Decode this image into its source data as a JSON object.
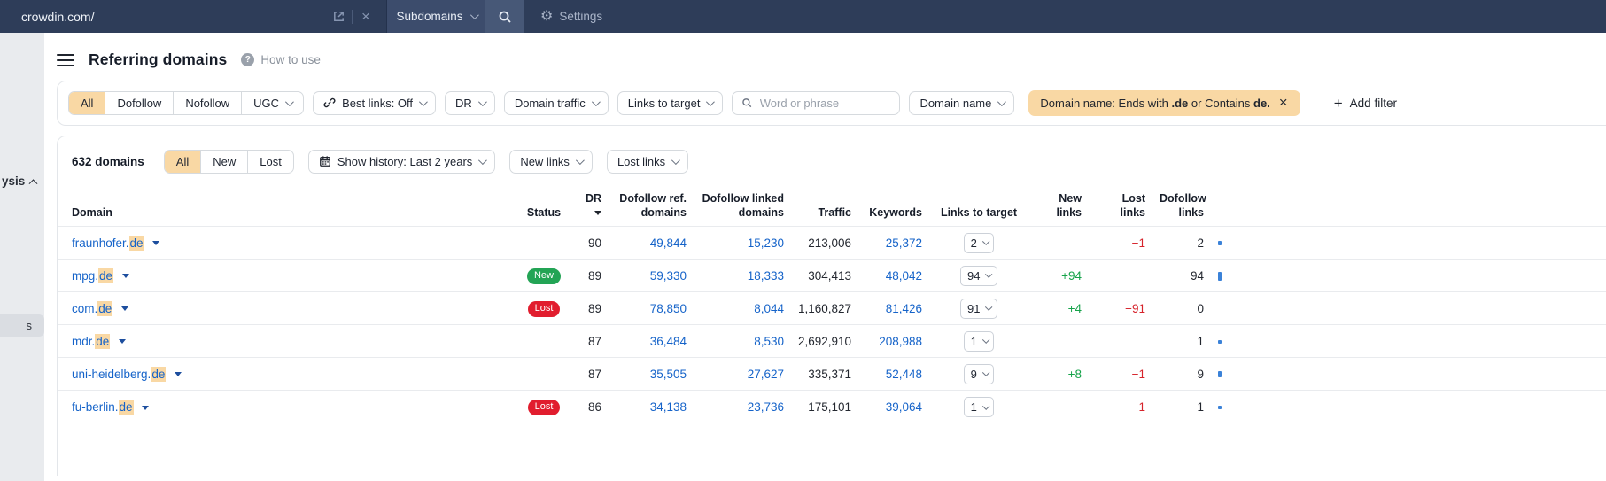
{
  "topbar": {
    "url_value": "crowdin.com/",
    "mode_selector": "Subdomains",
    "settings_label": "Settings"
  },
  "sidebar": {
    "fragment_top": "ysis",
    "fragment_item": "s"
  },
  "header": {
    "title": "Referring domains",
    "help_label": "How to use"
  },
  "filters": {
    "seg_all": "All",
    "seg_dofollow": "Dofollow",
    "seg_nofollow": "Nofollow",
    "seg_ugc": "UGC",
    "best_links": "Best links: Off",
    "dr": "DR",
    "domain_traffic": "Domain traffic",
    "links_to_target": "Links to target",
    "search_placeholder": "Word or phrase",
    "domain_name": "Domain name",
    "chip": {
      "part1": "Domain name: Ends with ",
      "bold1": ".de",
      "part2": " or Contains ",
      "bold2": "de."
    },
    "chip_close": "×",
    "add_filter": "Add filter",
    "plus": "+"
  },
  "toolbar": {
    "count": "632 domains",
    "seg_all": "All",
    "seg_new": "New",
    "seg_lost": "Lost",
    "show_history": "Show history: Last 2 years",
    "new_links": "New links",
    "lost_links": "Lost links"
  },
  "table": {
    "headers": [
      "Domain",
      "Status",
      "DR",
      "Dofollow ref. domains",
      "Dofollow linked domains",
      "Traffic",
      "Keywords",
      "Links to target",
      "New links",
      "Lost links",
      "Dofollow links"
    ],
    "rows": [
      {
        "domain_base": "fraunhofer.",
        "domain_hl": "de",
        "status": "",
        "dr": "90",
        "dofollow_ref": "49,844",
        "dofollow_linked": "15,230",
        "traffic": "213,006",
        "keywords": "25,372",
        "links_to_target": "2",
        "new_links": "",
        "lost_links": "−1",
        "dofollow_links": "2",
        "bar": 5
      },
      {
        "domain_base": "mpg.",
        "domain_hl": "de",
        "status": "New",
        "dr": "89",
        "dofollow_ref": "59,330",
        "dofollow_linked": "18,333",
        "traffic": "304,413",
        "keywords": "48,042",
        "links_to_target": "94",
        "new_links": "+94",
        "lost_links": "",
        "dofollow_links": "94",
        "bar": 10
      },
      {
        "domain_base": "com.",
        "domain_hl": "de",
        "status": "Lost",
        "dr": "89",
        "dofollow_ref": "78,850",
        "dofollow_linked": "8,044",
        "traffic": "1,160,827",
        "keywords": "81,426",
        "links_to_target": "91",
        "new_links": "+4",
        "lost_links": "−91",
        "dofollow_links": "0",
        "bar": 0
      },
      {
        "domain_base": "mdr.",
        "domain_hl": "de",
        "status": "",
        "dr": "87",
        "dofollow_ref": "36,484",
        "dofollow_linked": "8,530",
        "traffic": "2,692,910",
        "keywords": "208,988",
        "links_to_target": "1",
        "new_links": "",
        "lost_links": "",
        "dofollow_links": "1",
        "bar": 4
      },
      {
        "domain_base": "uni-heidelberg.",
        "domain_hl": "de",
        "status": "",
        "dr": "87",
        "dofollow_ref": "35,505",
        "dofollow_linked": "27,627",
        "traffic": "335,371",
        "keywords": "52,448",
        "links_to_target": "9",
        "new_links": "+8",
        "lost_links": "−1",
        "dofollow_links": "9",
        "bar": 7
      },
      {
        "domain_base": "fu-berlin.",
        "domain_hl": "de",
        "status": "Lost",
        "dr": "86",
        "dofollow_ref": "34,138",
        "dofollow_linked": "23,736",
        "traffic": "175,101",
        "keywords": "39,064",
        "links_to_target": "1",
        "new_links": "",
        "lost_links": "−1",
        "dofollow_links": "1",
        "bar": 4
      }
    ]
  },
  "colors": {
    "topbar_bg": "#2e3d59",
    "accent_peach": "#f9d8a4",
    "link_blue": "#1563c9",
    "positive_green": "#16a34a",
    "negative_red": "#d6232b",
    "pill_new": "#23a455",
    "pill_lost": "#e11d2e",
    "bar_blue": "#3b82d8"
  }
}
